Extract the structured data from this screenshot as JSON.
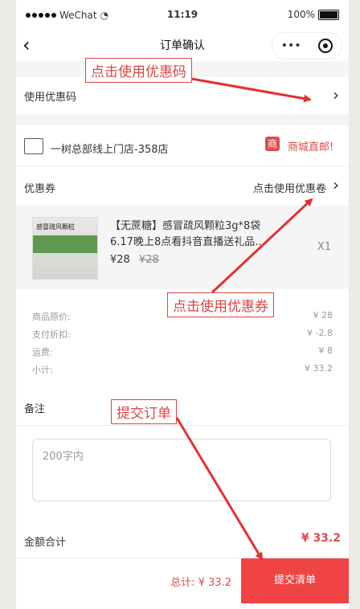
{
  "status_bar": {
    "carrier": "WeChat",
    "time": "11:19",
    "battery": "100%"
  },
  "nav": {
    "title": "订单确认"
  },
  "promo_row": {
    "label": "使用优惠码"
  },
  "store": {
    "name": "一树总部线上门店-358店",
    "badge": "商",
    "mall_text": "商城直邮!"
  },
  "coupon": {
    "label": "优惠券",
    "link": "点击使用优惠卷"
  },
  "product": {
    "title": "【无蔗糖】感冒疏风颗粒3g*8袋 6.17晚上8点看抖音直播送礼品...",
    "price": "¥28",
    "original_price": "¥28",
    "qty": "X1",
    "image_label": "感冒疏风颗粒"
  },
  "summary": [
    {
      "label": "商品原价:",
      "value": "¥ 28"
    },
    {
      "label": "支付折扣:",
      "value": "¥ -2.8"
    },
    {
      "label": "运费:",
      "value": "¥ 8"
    },
    {
      "label": "小计:",
      "value": "¥ 33.2"
    }
  ],
  "remark": {
    "label": "备注",
    "placeholder": "200字内"
  },
  "total": {
    "label": "金额合计",
    "value": "¥ 33.2"
  },
  "bottom_bar": {
    "total": "总计: ¥ 33.2",
    "submit": "提交清单"
  },
  "annotations": {
    "promo": "点击使用优惠码",
    "coupon": "点击使用优惠券",
    "submit": "提交订单"
  },
  "colors": {
    "accent": "#f04444",
    "annotation": "#dd4444"
  }
}
